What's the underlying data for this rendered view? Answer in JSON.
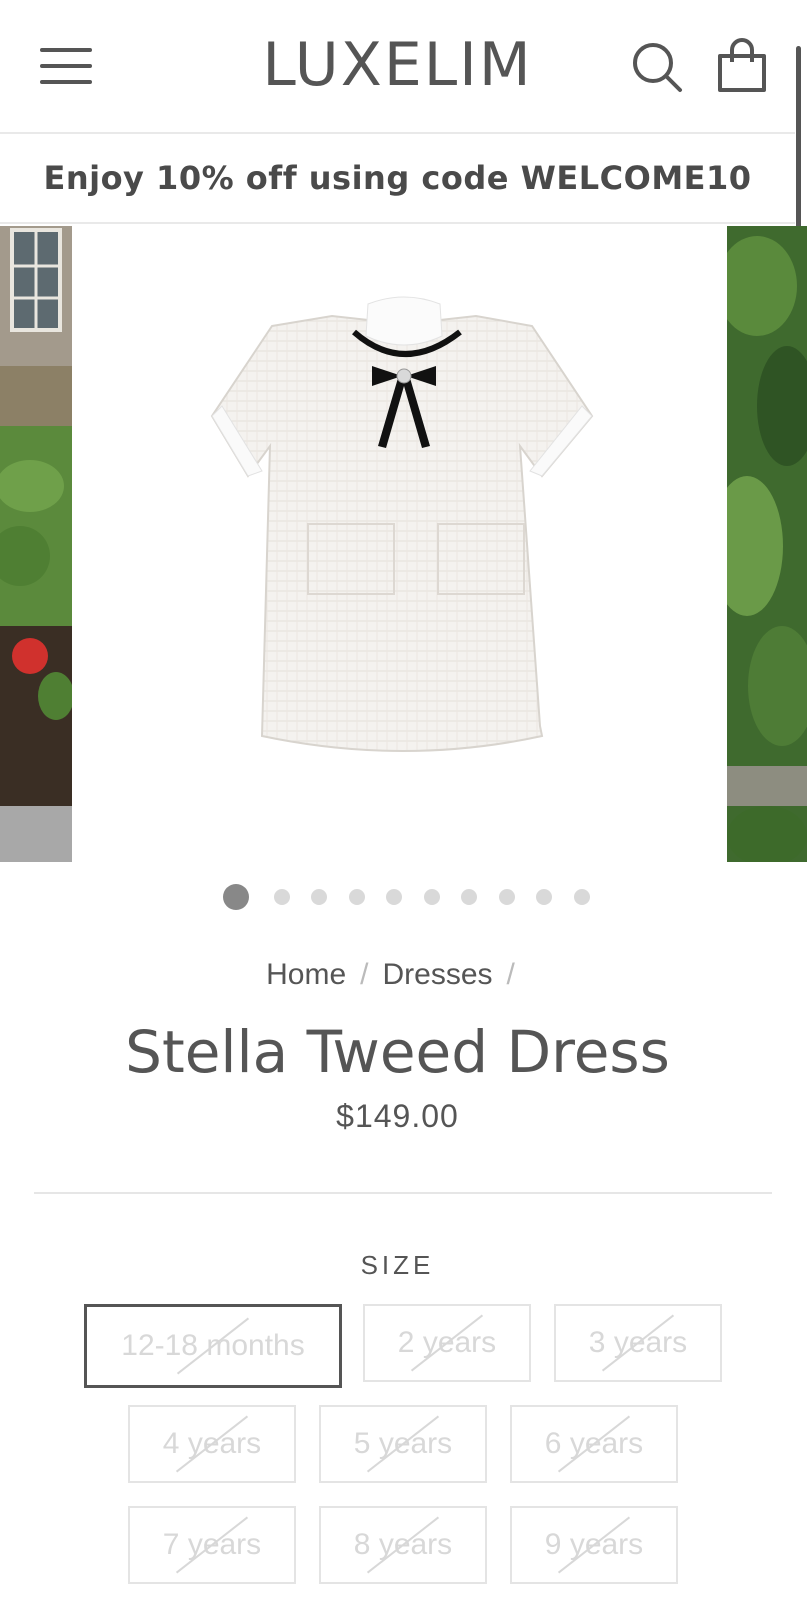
{
  "header": {
    "logo": "LUXELIM",
    "menu_icon": "hamburger-menu-icon",
    "search_icon": "search-icon",
    "cart_icon": "shopping-bag-icon"
  },
  "promo": {
    "text": "Enjoy 10% off using code WELCOME10"
  },
  "gallery": {
    "slide_count": 10,
    "active_index": 0
  },
  "breadcrumb": {
    "items": [
      "Home",
      "Dresses"
    ],
    "separator": "/"
  },
  "product": {
    "title": "Stella Tweed Dress",
    "price": "$149.00"
  },
  "size": {
    "label": "SIZE",
    "selected": "12-18 months",
    "options": [
      "12-18 months",
      "2 years",
      "3 years",
      "4 years",
      "5 years",
      "6 years",
      "7 years",
      "8 years",
      "9 years"
    ]
  },
  "colors": {
    "text": "#4a4a4a",
    "border": "#e4e4e4",
    "selected_border": "#555555",
    "dot_active": "#888888",
    "dot_inactive": "#d9d9d9"
  }
}
